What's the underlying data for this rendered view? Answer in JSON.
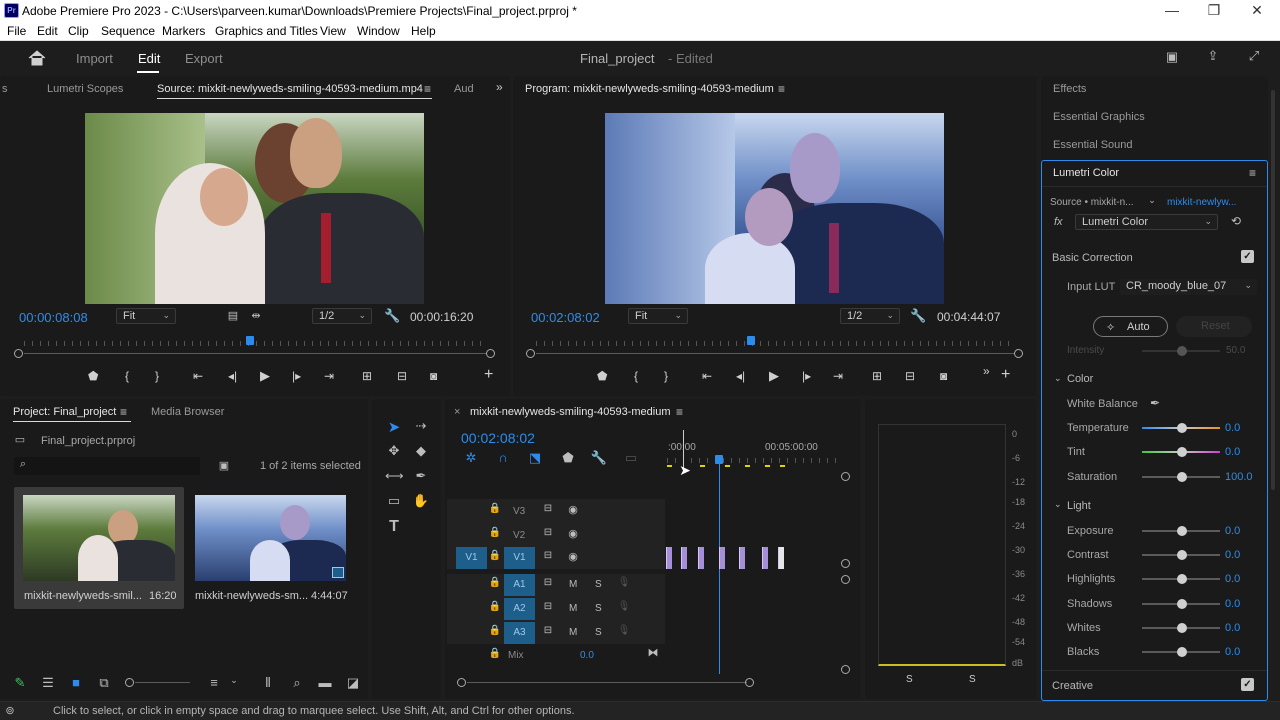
{
  "window": {
    "title": "Adobe Premiere Pro 2023 - C:\\Users\\parveen.kumar\\Downloads\\Premiere Projects\\Final_project.prproj *",
    "app_icon": "Pr",
    "minimize": "—",
    "maximize": "❐",
    "close": "✕"
  },
  "menu": [
    "File",
    "Edit",
    "Clip",
    "Sequence",
    "Markers",
    "Graphics and Titles",
    "View",
    "Window",
    "Help"
  ],
  "header": {
    "tabs": [
      "Import",
      "Edit",
      "Export"
    ],
    "active": "Edit",
    "project_name": "Final_project",
    "edited": "- Edited"
  },
  "source": {
    "tabs": [
      "s",
      "Lumetri Scopes",
      "Source: mixkit-newlyweds-smiling-40593-medium.mp4",
      "Aud"
    ],
    "timecode_in": "00:00:08:08",
    "fit": "Fit",
    "resolution": "1/2",
    "duration": "00:00:16:20",
    "playhead": 0.49
  },
  "program": {
    "tab": "Program: mixkit-newlyweds-smiling-40593-medium",
    "timecode": "00:02:08:02",
    "fit": "Fit",
    "resolution": "1/2",
    "duration": "00:04:44:07",
    "playhead": 0.45
  },
  "project": {
    "tabs": [
      "Project: Final_project",
      "Media Browser"
    ],
    "file": "Final_project.prproj",
    "count": "1 of 2 items selected",
    "items": [
      {
        "name": "mixkit-newlyweds-smil...",
        "duration": "16:20"
      },
      {
        "name": "mixkit-newlyweds-sm...",
        "duration": "4:44:07"
      }
    ]
  },
  "timeline": {
    "tab": "mixkit-newlyweds-smiling-40593-medium",
    "timecode": "00:02:08:02",
    "ruler": [
      ":00:00",
      "00:05:00:00"
    ],
    "video_tracks": [
      "V3",
      "V2",
      "V1"
    ],
    "audio_tracks": [
      "A1",
      "A2",
      "A3"
    ],
    "source_patch_v": "V1",
    "mute": "M",
    "solo": "S",
    "mix_label": "Mix",
    "mix_value": "0.0"
  },
  "meter": {
    "scale": [
      "0",
      "-6",
      "-12",
      "-18",
      "-24",
      "-30",
      "-36",
      "-42",
      "-48",
      "-54",
      "dB"
    ],
    "solo": [
      "S",
      "S"
    ]
  },
  "right_tabs": [
    "Effects",
    "Essential Graphics",
    "Essential Sound"
  ],
  "lumetri": {
    "title": "Lumetri Color",
    "source": "Source • mixkit-n...",
    "clip": "mixkit-newlyw...",
    "fx": "fx",
    "effect": "Lumetri Color",
    "basic_correction": "Basic Correction",
    "input_lut_label": "Input LUT",
    "input_lut": "CR_moody_blue_07",
    "auto": "Auto",
    "reset": "Reset",
    "intensity_label": "Intensity",
    "intensity": "50.0",
    "color_section": "Color",
    "white_balance": "White Balance",
    "color_params": [
      {
        "label": "Temperature",
        "value": "0.0"
      },
      {
        "label": "Tint",
        "value": "0.0"
      },
      {
        "label": "Saturation",
        "value": "100.0"
      }
    ],
    "light_section": "Light",
    "light_params": [
      {
        "label": "Exposure",
        "value": "0.0"
      },
      {
        "label": "Contrast",
        "value": "0.0"
      },
      {
        "label": "Highlights",
        "value": "0.0"
      },
      {
        "label": "Shadows",
        "value": "0.0"
      },
      {
        "label": "Whites",
        "value": "0.0"
      },
      {
        "label": "Blacks",
        "value": "0.0"
      }
    ],
    "creative": "Creative"
  },
  "status": "Click to select, or click in empty space and drag to marquee select. Use Shift, Alt, and Ctrl for other options.",
  "colors": {
    "accent": "#2d8ceb",
    "clip": "#a58fd6",
    "track_patch": "#1d5f8a"
  }
}
